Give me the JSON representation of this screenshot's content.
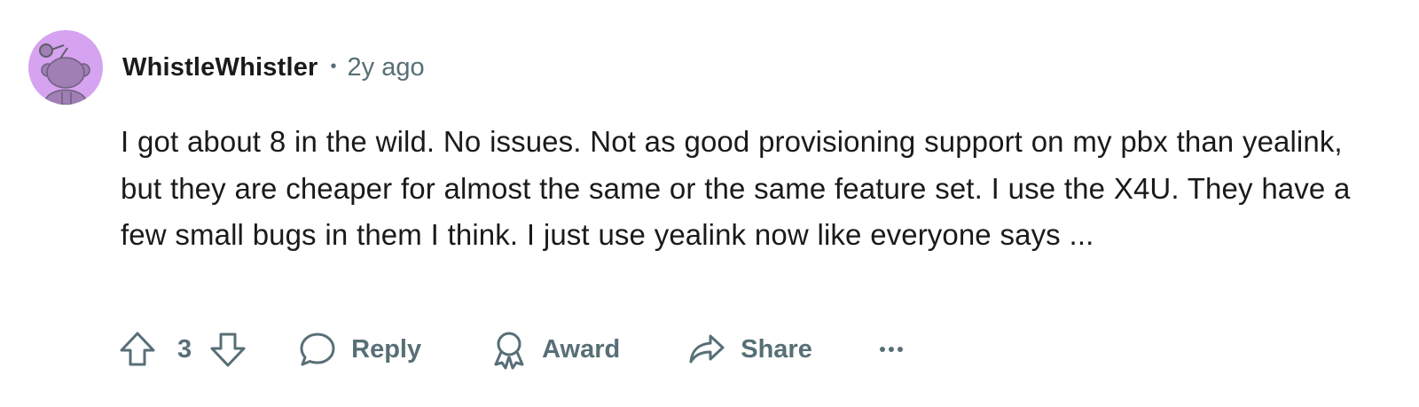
{
  "comment": {
    "author": "WhistleWhistler",
    "separator": "•",
    "timestamp": "2y ago",
    "avatar_icon": "snoo-avatar-icon",
    "avatar_bg": "#d5a3ef",
    "body": "I got about 8 in the wild. No issues. Not as good provisioning support on my pbx than yealink, but they are cheaper for almost the same or the same feature set. I use the X4U. They have a few small bugs in them I think. I just use yealink now like everyone says ..."
  },
  "actions": {
    "upvote_icon": "upvote-arrow-icon",
    "vote_count": "3",
    "downvote_icon": "downvote-arrow-icon",
    "reply_icon": "speech-bubble-icon",
    "reply_label": "Reply",
    "award_icon": "award-ribbon-icon",
    "award_label": "Award",
    "share_icon": "share-arrow-icon",
    "share_label": "Share",
    "more_icon": "ellipsis-icon"
  },
  "colors": {
    "text": "#1a1a1b",
    "muted": "#576f76"
  }
}
